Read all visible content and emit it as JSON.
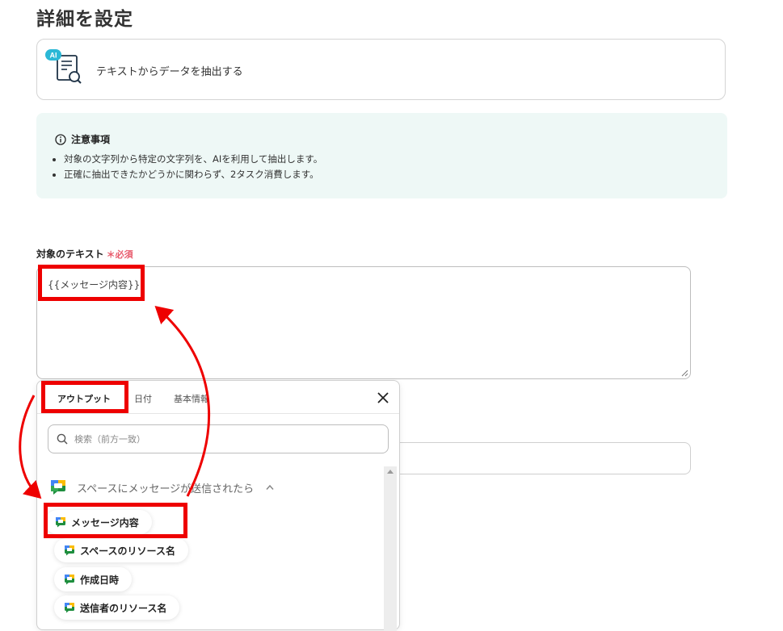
{
  "page": {
    "title": "詳細を設定"
  },
  "action": {
    "badge": "AI",
    "label": "テキストからデータを抽出する"
  },
  "notice": {
    "title": "注意事項",
    "items": [
      "対象の文字列から特定の文字列を、AIを利用して抽出します。",
      "正確に抽出できたかどうかに関わらず、2タスク消費します。"
    ]
  },
  "field": {
    "label": "対象のテキスト",
    "required_mark": "＊",
    "required_text": "必須",
    "value": "{{メッセージ内容}}"
  },
  "popup": {
    "tabs": [
      "アウトプット",
      "日付",
      "基本情報"
    ],
    "active_tab": "アウトプット",
    "search_placeholder": "検索（前方一致）",
    "group_label": "スペースにメッセージが送信されたら",
    "items": [
      "メッセージ内容",
      "スペースのリソース名",
      "作成日時",
      "送信者のリソース名"
    ]
  },
  "colors": {
    "highlight": "#ee0000",
    "notice_bg": "#eef8f6",
    "required": "#e85b6c",
    "ai_badge": "#2bb8d6"
  },
  "icons": [
    "ai-document-search-icon",
    "info-icon",
    "close-icon",
    "search-icon",
    "google-chat-icon",
    "chevron-up-icon"
  ]
}
